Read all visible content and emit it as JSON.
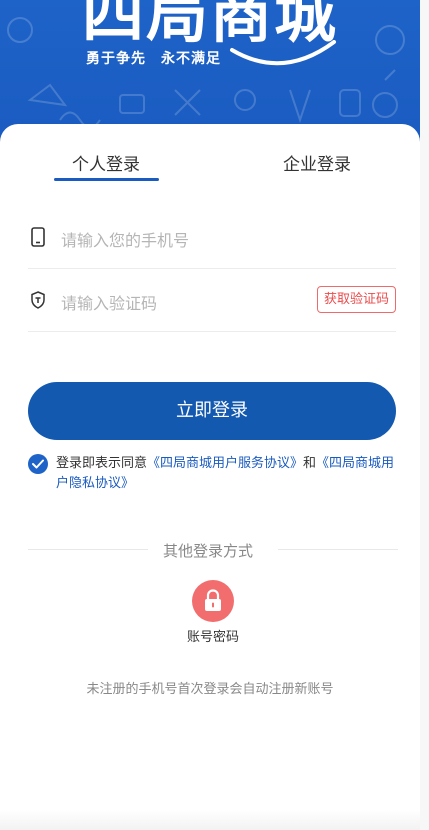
{
  "brand": {
    "logo_text": "四局商城",
    "slogan": "勇于争先　永不满足",
    "accent_color": "#1a5bc0"
  },
  "tabs": [
    {
      "label": "个人登录",
      "active": true
    },
    {
      "label": "企业登录",
      "active": false
    }
  ],
  "form": {
    "phone_placeholder": "请输入您的手机号",
    "code_placeholder": "请输入验证码",
    "get_code_label": "获取验证码",
    "phone_icon": "phone-icon",
    "code_icon": "shield-icon"
  },
  "login_button": {
    "label": "立即登录"
  },
  "agreement": {
    "checked": true,
    "prefix": "登录即表示同意",
    "service_link": "《四局商城用户服务协议》",
    "and": "和",
    "privacy_link": "《四局商城用户隐私协议》"
  },
  "other_login": {
    "title": "其他登录方式",
    "method_label": "账号密码",
    "method_icon": "lock-icon"
  },
  "notice": "未注册的手机号首次登录会自动注册新账号"
}
